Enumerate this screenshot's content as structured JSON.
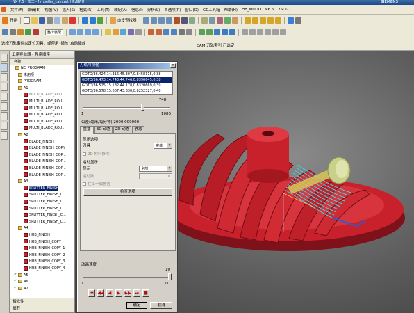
{
  "app": {
    "title": "NX 7.5 - 加工 - [impeller_cam.prt (修改的)]",
    "brand": "SIEMENS"
  },
  "menubar": [
    {
      "label": "文件(F)"
    },
    {
      "label": "编辑(E)"
    },
    {
      "label": "视图(V)"
    },
    {
      "label": "插入(S)"
    },
    {
      "label": "格式(R)"
    },
    {
      "label": "工具(T)"
    },
    {
      "label": "装配(A)"
    },
    {
      "label": "信息(I)"
    },
    {
      "label": "分析(L)"
    },
    {
      "label": "首选项(P)"
    },
    {
      "label": "窗口(O)"
    },
    {
      "label": "GC工具箱"
    },
    {
      "label": "帮助(H)"
    },
    {
      "label": "HB_MOULD M6.6"
    },
    {
      "label": "YSUG"
    }
  ],
  "toolbar": {
    "start_label": "开始",
    "command_finder": "命令查找器",
    "filter_value": "整个装配"
  },
  "status": {
    "left": "选择刀轨事件以定位刀具，或使用“播放”启动播放",
    "right": "CAM 刀轨索引 已选定"
  },
  "navigator": {
    "title": "工序导航器 - 程序顺序",
    "column_name": "名称",
    "rows": [
      {
        "label": "NC_PROGRAM",
        "type": "root",
        "check": ""
      },
      {
        "label": "未用项",
        "type": "group",
        "check": ""
      },
      {
        "label": "PROGRAM",
        "type": "group",
        "check": ""
      },
      {
        "label": "A1",
        "type": "group",
        "check": ""
      },
      {
        "label": "MULTI_BLADE_ROU...",
        "type": "op",
        "check": "",
        "grey": true
      },
      {
        "label": "MULTI_BLADE_ROU...",
        "type": "op",
        "check": ""
      },
      {
        "label": "MULTI_BLADE_ROU...",
        "type": "op",
        "check": ""
      },
      {
        "label": "MULTI_BLADE_ROU...",
        "type": "op",
        "check": ""
      },
      {
        "label": "MULTI_BLADE_ROU...",
        "type": "op",
        "check": ""
      },
      {
        "label": "MULTI_BLADE_ROU...",
        "type": "op",
        "check": ""
      },
      {
        "label": "A2",
        "type": "group",
        "check": ""
      },
      {
        "label": "BLADE_FINISH",
        "type": "op",
        "check": ""
      },
      {
        "label": "BLADE_FINISH_COPY",
        "type": "op",
        "check": ""
      },
      {
        "label": "BLADE_FINISH_COP...",
        "type": "op",
        "check": ""
      },
      {
        "label": "BLADE_FINISH_COP...",
        "type": "op",
        "check": ""
      },
      {
        "label": "BLADE_FINISH_COP...",
        "type": "op",
        "check": ""
      },
      {
        "label": "BLADE_FINISH_COP...",
        "type": "op",
        "check": ""
      },
      {
        "label": "A3",
        "type": "group",
        "check": ""
      },
      {
        "label": "SPLITTER_FINISH",
        "type": "op",
        "check": "",
        "selected": true
      },
      {
        "label": "SPLITTER_FINISH_C...",
        "type": "op",
        "check": ""
      },
      {
        "label": "SPLITTER_FINISH_C...",
        "type": "op",
        "check": ""
      },
      {
        "label": "SPLITTER_FINISH_C...",
        "type": "op",
        "check": ""
      },
      {
        "label": "SPLITTER_FINISH_C...",
        "type": "op",
        "check": ""
      },
      {
        "label": "SPLITTER_FINISH_C...",
        "type": "op",
        "check": ""
      },
      {
        "label": "A4",
        "type": "group",
        "check": ""
      },
      {
        "label": "HUB_FINISH",
        "type": "op",
        "check": ""
      },
      {
        "label": "HUB_FINISH_COPY",
        "type": "op",
        "check": ""
      },
      {
        "label": "HUB_FINISH_COPY_1",
        "type": "op",
        "check": ""
      },
      {
        "label": "HUB_FINISH_COPY_2",
        "type": "op",
        "check": ""
      },
      {
        "label": "HUB_FINISH_COPY_3",
        "type": "op",
        "check": ""
      },
      {
        "label": "HUB_FINISH_COPY_4",
        "type": "op",
        "check": ""
      },
      {
        "label": "A5",
        "type": "group",
        "check": "✔"
      },
      {
        "label": "A6",
        "type": "group",
        "check": "✔"
      },
      {
        "label": "A7",
        "type": "group",
        "check": "✔"
      }
    ],
    "bottom": [
      "相依性",
      "细节"
    ]
  },
  "dialog": {
    "title": "刀轨可视化",
    "close": "×",
    "cls_lines": [
      {
        "text": "GOTO/36.424,14.316,45.307,0.8458115,0.38",
        "selected": false
      },
      {
        "text": "GOTO/36.473,14.743,44.746,0.8390645,0.38",
        "selected": true
      },
      {
        "text": "GOTO/36.525,15.182,44.178,0.8320669,0.39",
        "selected": false
      },
      {
        "text": "GOTO/36.578,15.607,43.630,0.8252327,0.40",
        "selected": false
      }
    ],
    "slider": {
      "value": "748",
      "min": "1",
      "max": "1086",
      "fraction": 0.688
    },
    "tolerance": "公差(毫米/每分钟)  2000.000000",
    "tabs": [
      "重播",
      "3D 动态",
      "2D 动态",
      "静态"
    ],
    "section1": "显示选项",
    "tool_label": "刀具",
    "tool_value": "实体",
    "chk_2d": "2D 材料移除",
    "section2": "运动显示",
    "display_label": "显示",
    "display_value": "全部",
    "motions_label": "运动数",
    "motions_value": "10",
    "chk_pause": "在每一個警告",
    "check_button": "检查选项",
    "speed_label": "动画速度",
    "speed": {
      "value": "10",
      "min": "1",
      "max": "10",
      "fraction": 1.0
    },
    "playback": [
      "⏮",
      "◀◀",
      "◀",
      "▶",
      "▶▶",
      "⏭",
      "■"
    ],
    "ok": "确定",
    "cancel": "取消"
  },
  "colors": {
    "part": "#c8212b",
    "toolpath": "#3fd7e6",
    "tool": "#c9d08a",
    "selection": "#0a246a"
  }
}
